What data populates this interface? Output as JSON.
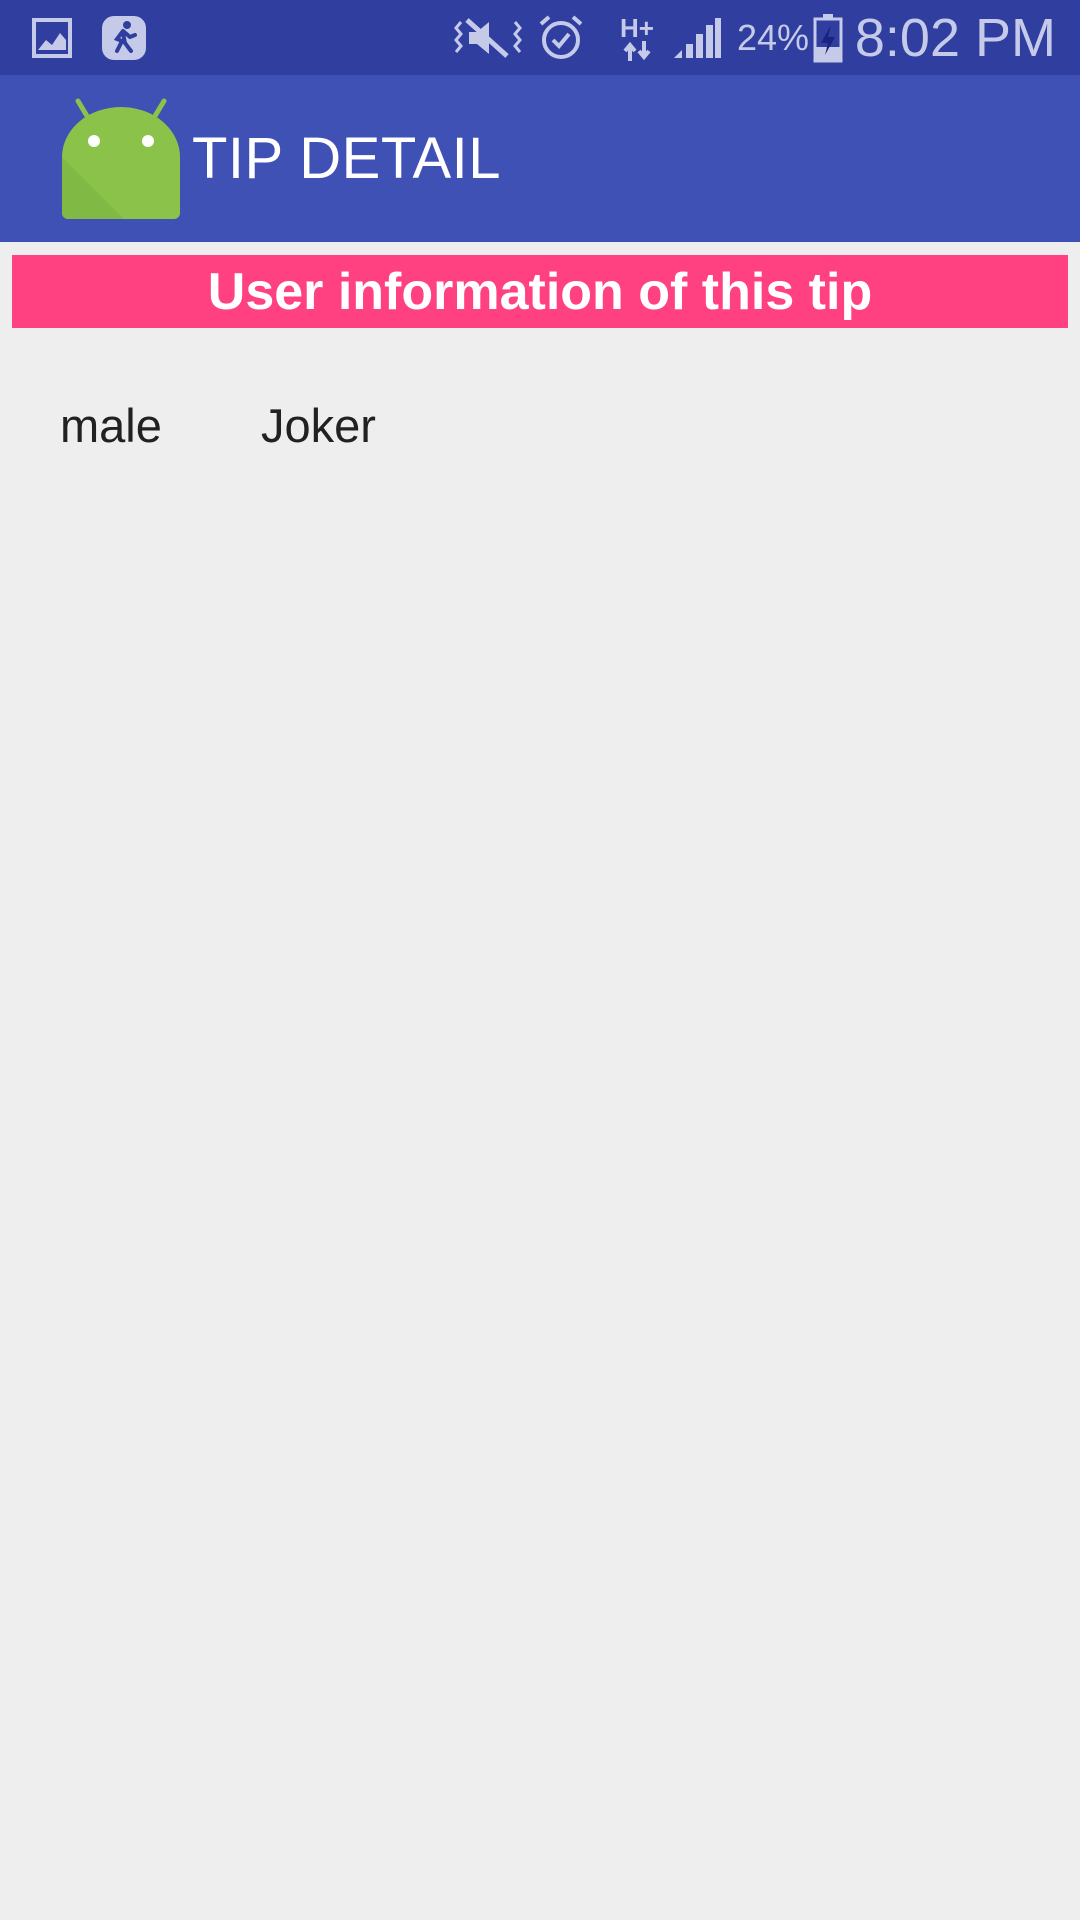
{
  "status_bar": {
    "icons": [
      "gallery-icon",
      "runner-app-icon",
      "vibrate-mute-icon",
      "alarm-icon",
      "network-hplus-icon",
      "signal-icon",
      "battery-charging-icon"
    ],
    "network_label": "H+",
    "battery_percent": "24%",
    "time": "8:02 PM",
    "text_color": "#c5cae9",
    "background": "#303f9f"
  },
  "app_bar": {
    "logo_icon": "android-icon",
    "title": "TIP DETAIL",
    "background": "#3f51b5"
  },
  "section": {
    "header": "User information of this tip",
    "background": "#ff4081"
  },
  "user": {
    "gender": "male",
    "name": "Joker"
  }
}
